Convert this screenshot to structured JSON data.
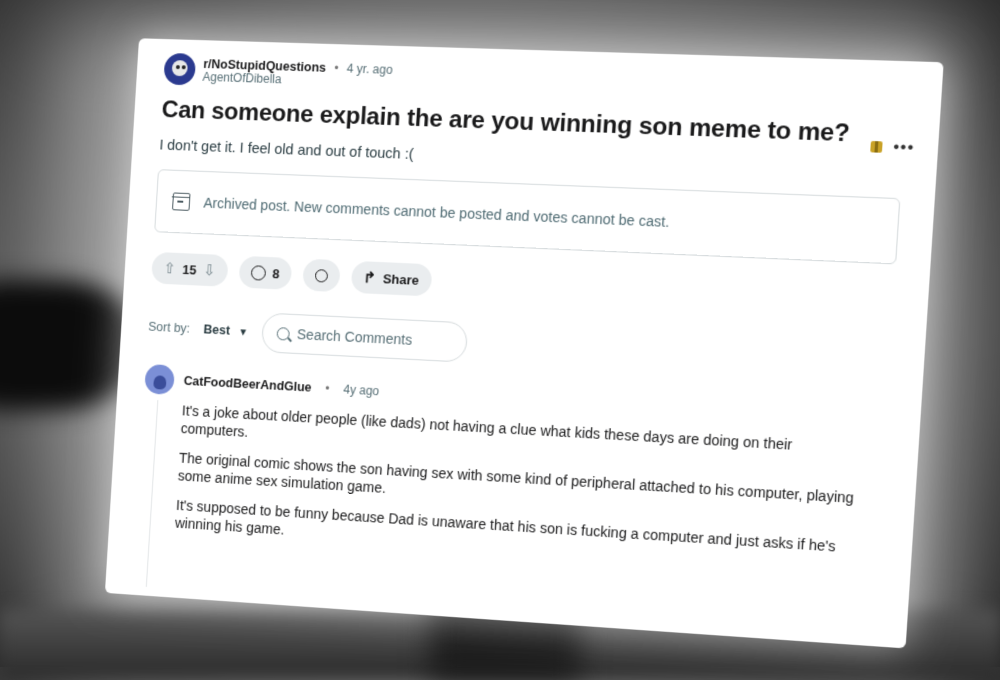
{
  "post": {
    "subreddit": "r/NoStupidQuestions",
    "age": "4 yr. ago",
    "author": "AgentOfDibella",
    "title": "Can someone explain the are you winning son meme to me?",
    "body": "I don't get it. I feel old and out of touch :(",
    "archived_notice": "Archived post. New comments cannot be posted and votes cannot be cast."
  },
  "actions": {
    "vote_count": "15",
    "comment_count": "8",
    "share_label": "Share"
  },
  "sort": {
    "label": "Sort by:",
    "value": "Best"
  },
  "search": {
    "placeholder": "Search Comments"
  },
  "comment": {
    "author": "CatFoodBeerAndGlue",
    "age": "4y ago",
    "paragraphs": [
      "It's a joke about older people (like dads) not having a clue what kids these days are doing on their computers.",
      "The original comic shows the son having sex with some kind of peripheral attached to his computer, playing some anime sex simulation game.",
      "It's supposed to be funny because Dad is unaware that his son is fucking a computer and just asks if he's winning his game."
    ]
  },
  "icons": [
    "subreddit-avatar-icon",
    "gift-icon",
    "more-options-icon",
    "archive-icon",
    "upvote-icon",
    "downvote-icon",
    "comment-icon",
    "award-icon",
    "share-icon",
    "chevron-down-icon",
    "search-icon",
    "user-avatar-icon"
  ]
}
